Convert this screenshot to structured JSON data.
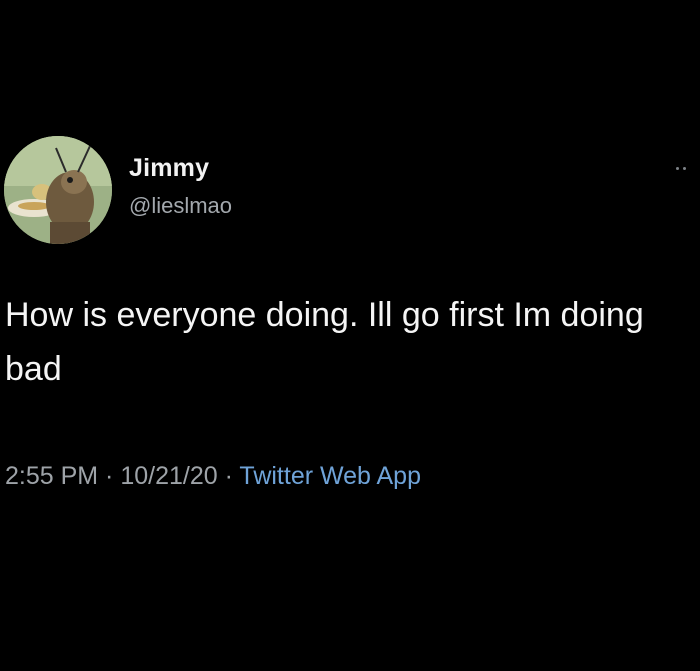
{
  "user": {
    "display_name": "Jimmy",
    "handle": "@lieslmao",
    "avatar_icon": "cartoon-bug-avatar"
  },
  "tweet": {
    "text": "How is everyone doing. Ill go first Im doing bad",
    "time": "2:55 PM",
    "separator": " · ",
    "date": "10/21/20",
    "source": "Twitter Web App"
  },
  "actions": {
    "more_icon": "more-dots-icon"
  },
  "colors": {
    "background": "#000000",
    "text": "#f5f5f5",
    "secondary_text": "#9ea3a8",
    "link": "#6fa3d8"
  }
}
